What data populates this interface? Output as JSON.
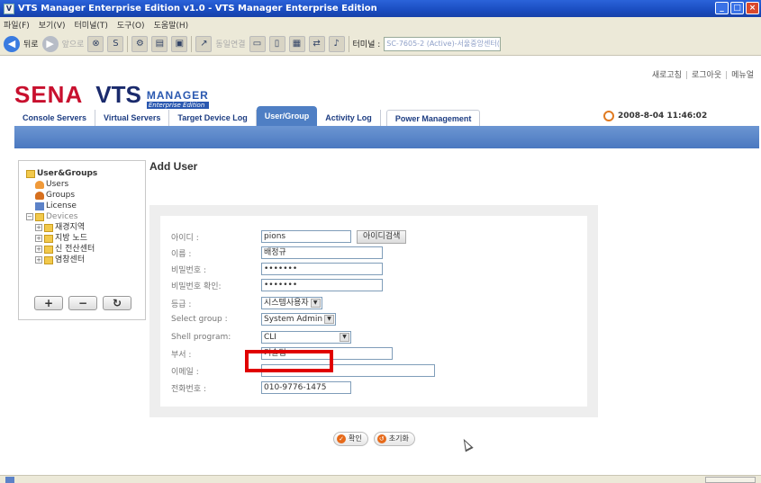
{
  "window": {
    "title": "VTS Manager Enterprise Edition v1.0 - VTS Manager Enterprise Edition",
    "minimize": "_",
    "maximize": "□",
    "close": "×"
  },
  "menu": [
    "파일(F)",
    "보기(V)",
    "터미널(T)",
    "도구(O)",
    "도움말(H)"
  ],
  "toolbar": {
    "back_label": "뒤로",
    "forward_label": "앞으로",
    "connect_label": "동일연결",
    "terminal_label": "터미널 :",
    "terminal_value": "SC-7605-2 (Active)-서울중앙센터("
  },
  "header": {
    "links": [
      "새로고침",
      "로그아웃",
      "메뉴얼"
    ],
    "logo_sena": "SENA",
    "logo_vts": "VTS",
    "logo_manager": "MANAGER",
    "logo_edition": "Enterprise Edition",
    "datetime": "2008-8-04 11:46:02"
  },
  "tabs": [
    {
      "label": "Console Servers"
    },
    {
      "label": "Virtual Servers"
    },
    {
      "label": "Target Device Log"
    },
    {
      "label": "User/Group"
    },
    {
      "label": "Activity Log"
    },
    {
      "label": "Power Management"
    }
  ],
  "active_tab": "User/Group",
  "sidebar": {
    "root": "User&Groups",
    "items": [
      "Users",
      "Groups",
      "License"
    ],
    "devices_label": "Devices",
    "devices": [
      "재경지역",
      "지방 노드",
      "신 전산센터",
      "염창센터"
    ],
    "add_label": "+",
    "remove_label": "−",
    "refresh_label": "↻"
  },
  "form": {
    "title": "Add User",
    "id_label": "아이디 :",
    "id_value": "pions",
    "id_search_button": "아이디검색",
    "name_label": "이름 :",
    "name_value": "배정규",
    "password_label": "비밀번호 :",
    "password_value": "•••••••",
    "password_confirm_label": "비밀번호 확인:",
    "password_confirm_value": "•••••••",
    "level_label": "등급 :",
    "level_value": "시스템사용자",
    "group_label": "Select group :",
    "group_value": "System Admin",
    "shell_label": "Shell program:",
    "shell_value": "CLI",
    "dept_label": "부서 :",
    "dept_value": "기술팀",
    "email_label": "이메일 :",
    "email_value": "",
    "phone_label": "전화번호 :",
    "phone_value": "010-9776-1475",
    "confirm_button": "확인",
    "reset_button": "초기화"
  },
  "colors": {
    "title_bar": "#1a4cc0",
    "accent_blue": "#4f7fc4",
    "highlight_red": "#e00000",
    "logo_red": "#c8102e",
    "logo_navy": "#1a2a6c"
  }
}
